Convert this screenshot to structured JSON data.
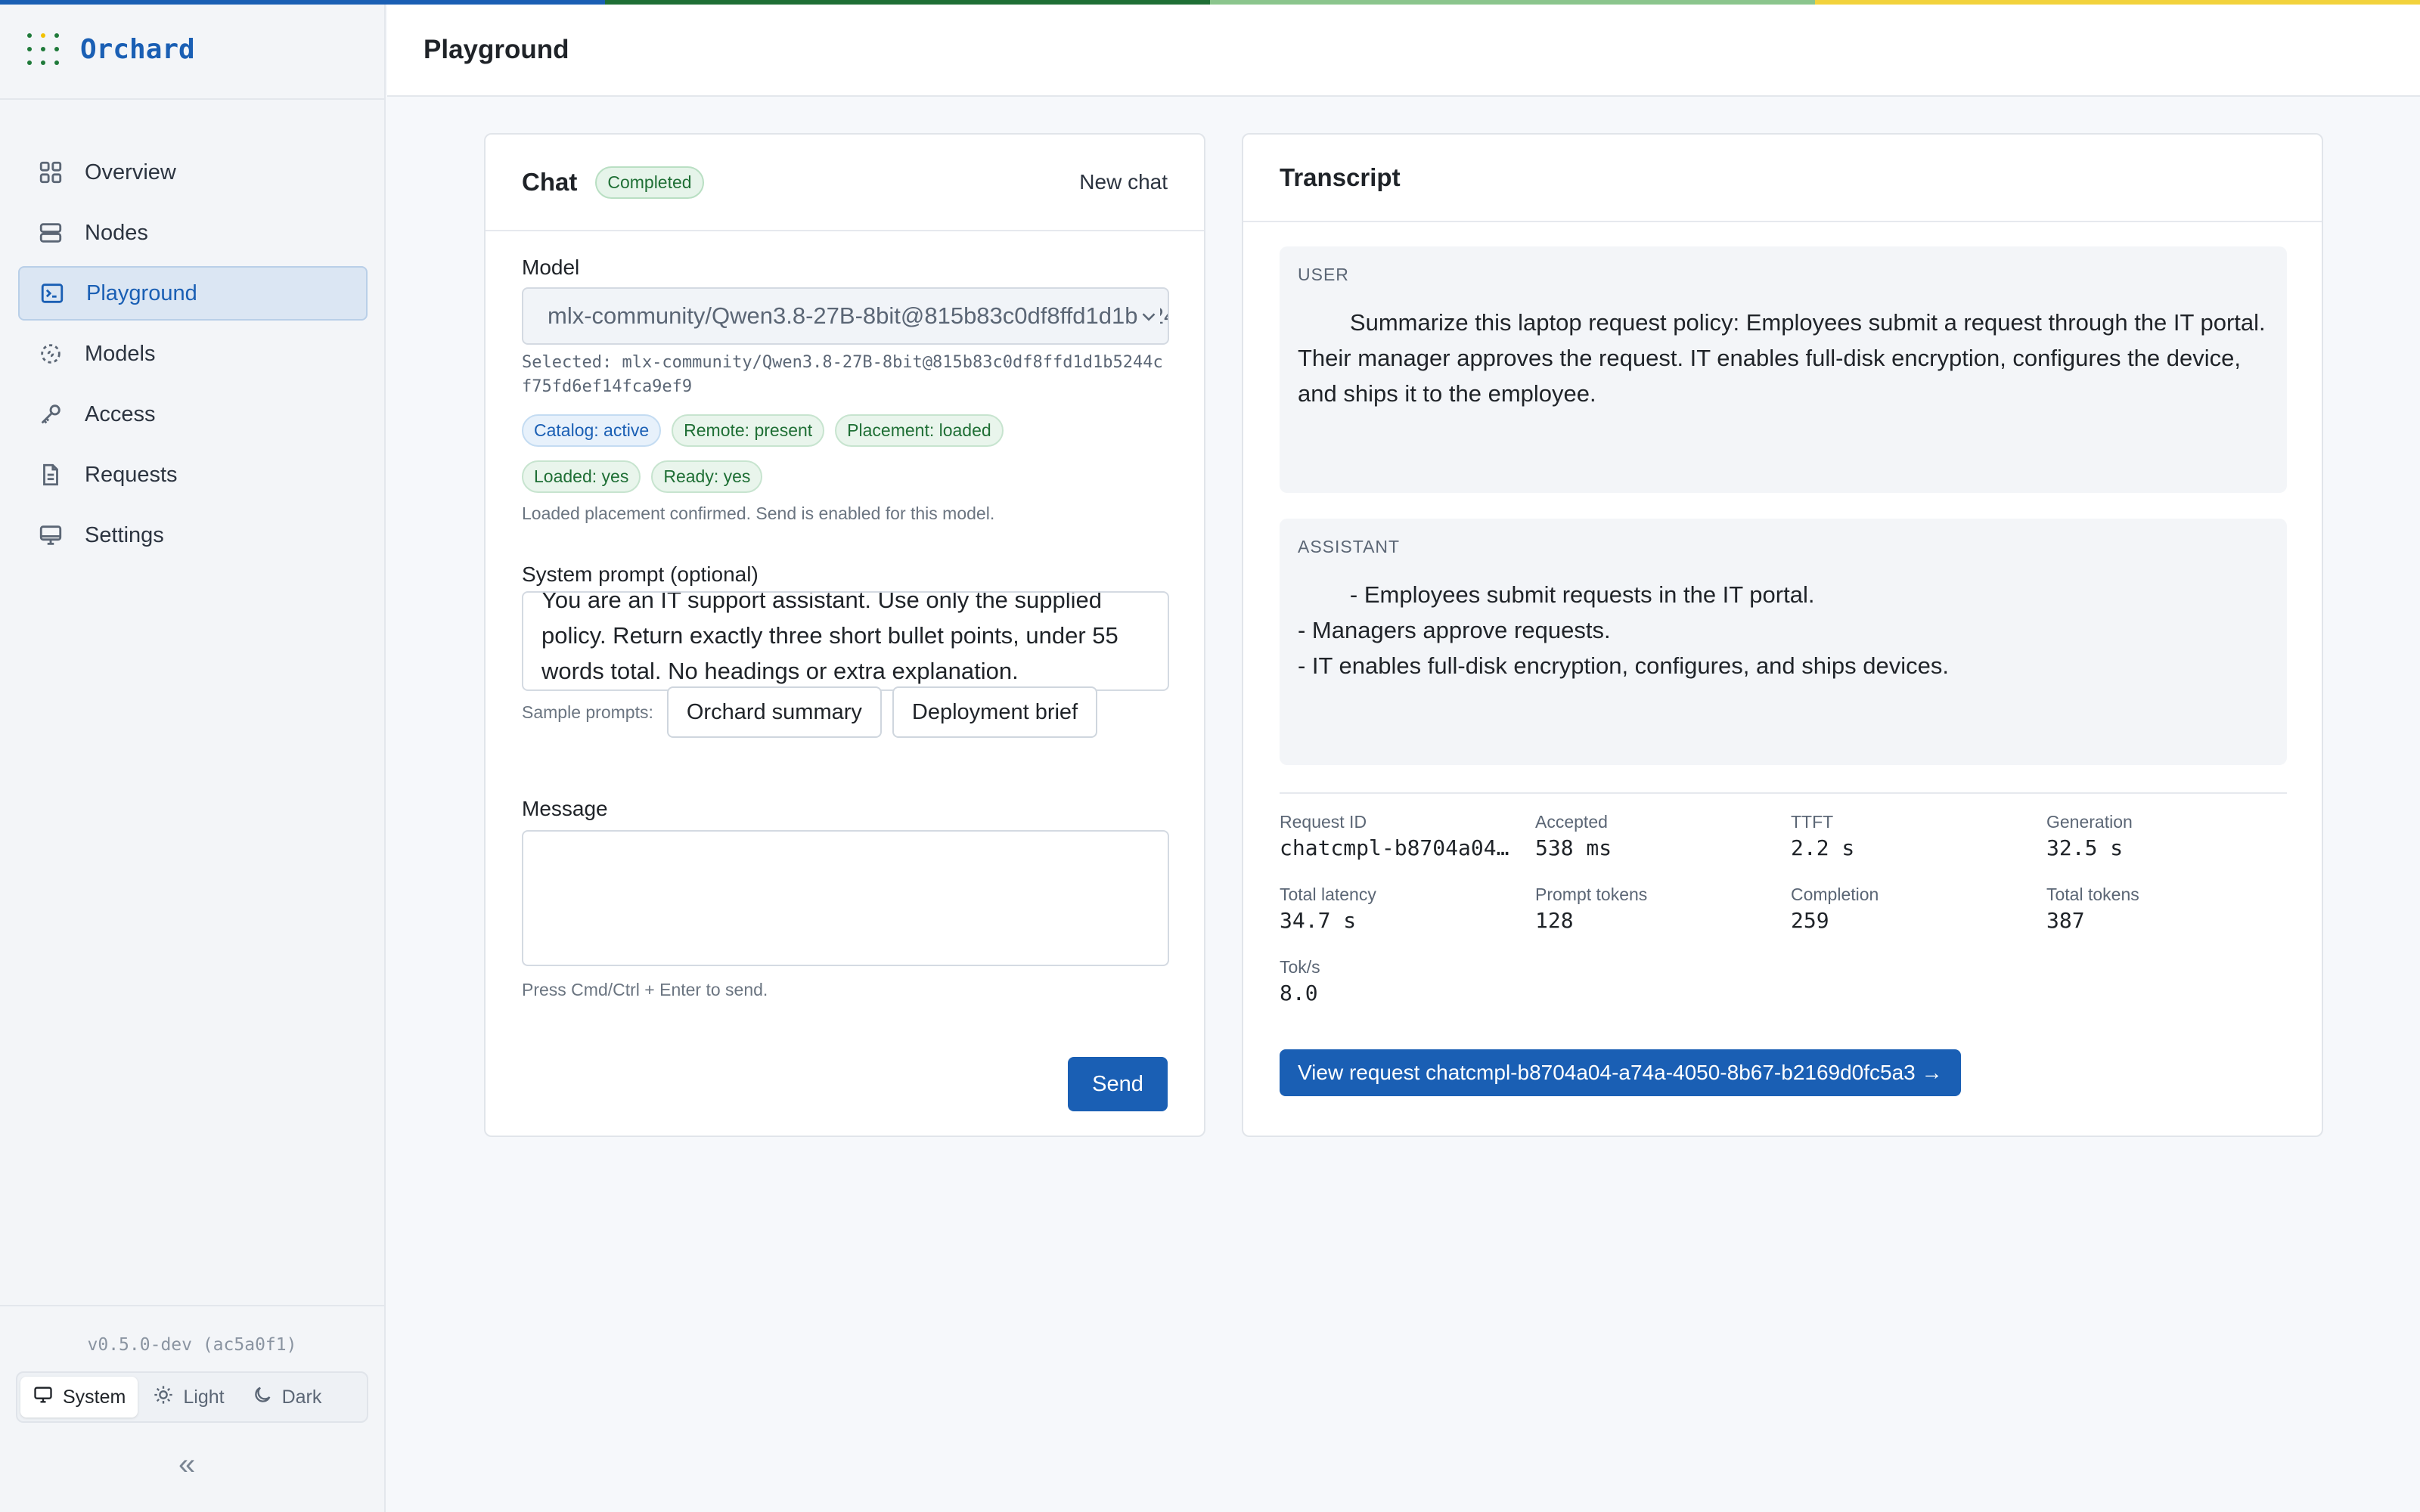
{
  "colors": {
    "accent": "#1a5fb4",
    "top_stripe": [
      "#1a5fb4",
      "#1f6f35",
      "#8bc58d",
      "#f2d23c"
    ]
  },
  "app": {
    "name": "Orchard"
  },
  "sidebar": {
    "items": [
      {
        "label": "Overview",
        "icon": "grid-icon",
        "active": false
      },
      {
        "label": "Nodes",
        "icon": "server-icon",
        "active": false
      },
      {
        "label": "Playground",
        "icon": "terminal-icon",
        "active": true
      },
      {
        "label": "Models",
        "icon": "models-icon",
        "active": false
      },
      {
        "label": "Access",
        "icon": "key-icon",
        "active": false
      },
      {
        "label": "Requests",
        "icon": "document-icon",
        "active": false
      },
      {
        "label": "Settings",
        "icon": "monitor-icon",
        "active": false
      }
    ],
    "version": "v0.5.0-dev (ac5a0f1)",
    "theme": {
      "options": [
        "System",
        "Light",
        "Dark"
      ],
      "selected": "System"
    },
    "collapse_glyph": "«"
  },
  "header": {
    "title": "Playground"
  },
  "chat": {
    "title": "Chat",
    "status": "Completed",
    "new_chat_label": "New chat",
    "model_label": "Model",
    "model_value": "mlx-community/Qwen3.8-27B-8bit@815b83c0df8ffd1d1b5244cf75fd6ef14fca9ef9",
    "selected_text": "Selected: mlx-community/Qwen3.8-27B-8bit@815b83c0df8ffd1d1b5244cf75fd6ef14fca9ef9",
    "badges_row1": [
      "Catalog: active",
      "Remote: present",
      "Placement: loaded"
    ],
    "badges_row2": [
      "Loaded: yes",
      "Ready: yes"
    ],
    "placement_note": "Loaded placement confirmed. Send is enabled for this model.",
    "system_prompt_label": "System prompt (optional)",
    "system_prompt_value": "You are an IT support assistant. Use only the supplied policy. Return exactly three short bullet points, under 55 words total. No headings or extra explanation.",
    "sample_prompts_label": "Sample prompts:",
    "sample_prompts": [
      "Orchard summary",
      "Deployment brief"
    ],
    "message_label": "Message",
    "message_value": "",
    "send_hint": "Press Cmd/Ctrl + Enter to send.",
    "send_label": "Send"
  },
  "transcript": {
    "title": "Transcript",
    "messages": [
      {
        "role": "USER",
        "text": "        Summarize this laptop request policy: Employees submit a request through the IT portal. Their manager approves the request. IT enables full-disk encryption, configures the device, and ships it to the employee."
      },
      {
        "role": "ASSISTANT",
        "text": "        - Employees submit requests in the IT portal.\n- Managers approve requests.\n- IT enables full-disk encryption, configures, and ships devices."
      }
    ],
    "stats": [
      {
        "label": "Request ID",
        "value": "chatcmpl-b8704a04…"
      },
      {
        "label": "Accepted",
        "value": "538 ms"
      },
      {
        "label": "TTFT",
        "value": "2.2 s"
      },
      {
        "label": "Generation",
        "value": "32.5 s"
      },
      {
        "label": "Total latency",
        "value": "34.7 s"
      },
      {
        "label": "Prompt tokens",
        "value": "128"
      },
      {
        "label": "Completion",
        "value": "259"
      },
      {
        "label": "Total tokens",
        "value": "387"
      },
      {
        "label": "Tok/s",
        "value": "8.0"
      }
    ],
    "view_request_label": "View request chatcmpl-b8704a04-a74a-4050-8b67-b2169d0fc5a3 →"
  }
}
